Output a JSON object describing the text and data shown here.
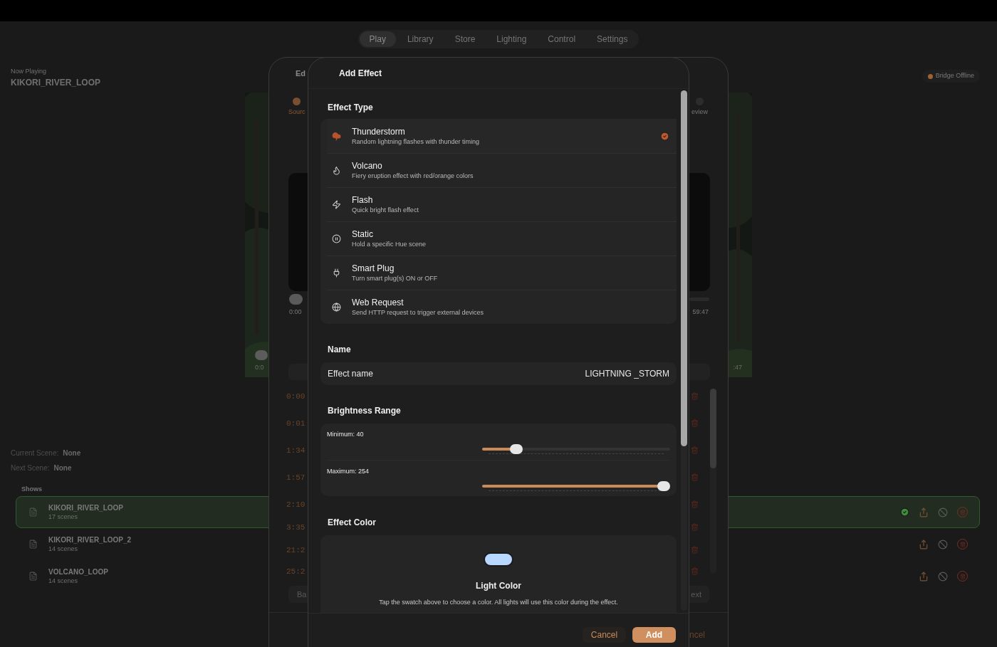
{
  "tabs": [
    {
      "label": "Play",
      "selected": true
    },
    {
      "label": "Library",
      "selected": false
    },
    {
      "label": "Store",
      "selected": false
    },
    {
      "label": "Lighting",
      "selected": false
    },
    {
      "label": "Control",
      "selected": false
    },
    {
      "label": "Settings",
      "selected": false
    }
  ],
  "now_playing": {
    "label": "Now Playing",
    "title": "KIKORI_RIVER_LOOP"
  },
  "bridge_status": {
    "label": "Bridge Offline",
    "color": "#a0622e"
  },
  "video": {
    "time_start": "0:0",
    "time_end": ":47"
  },
  "scene_info": [
    {
      "label": "Current Scene:",
      "value": "None"
    },
    {
      "label": "Next Scene:",
      "value": "None"
    }
  ],
  "shows": {
    "heading": "Shows",
    "items": [
      {
        "name": "KIKORI_RIVER_LOOP",
        "count": "17 scenes",
        "selected": true
      },
      {
        "name": "KIKORI_RIVER_LOOP_2",
        "count": "14 scenes",
        "selected": false
      },
      {
        "name": "VOLCANO_LOOP",
        "count": "14 scenes",
        "selected": false
      }
    ]
  },
  "edit_sheet": {
    "title": "Ed",
    "steps": [
      {
        "label": "Sourc",
        "selected": true
      },
      {
        "label": "eview",
        "selected": false
      }
    ],
    "time_start": "0:00",
    "time_end": "59:47",
    "cue_times": [
      "0:00",
      "0:01",
      "1:34",
      "1:57",
      "2:10",
      "3:35",
      "21:2",
      "25:2"
    ],
    "back_button": "Ba",
    "next_button": "ext",
    "cancel_button": "ncel"
  },
  "add_effect": {
    "title": "Add Effect",
    "effect_type": {
      "heading": "Effect Type",
      "options": [
        {
          "name": "Thunderstorm",
          "description": "Random lightning flashes with thunder timing",
          "selected": true
        },
        {
          "name": "Volcano",
          "description": "Fiery eruption effect with red/orange colors",
          "selected": false
        },
        {
          "name": "Flash",
          "description": "Quick bright flash effect",
          "selected": false
        },
        {
          "name": "Static",
          "description": "Hold a specific Hue scene",
          "selected": false
        },
        {
          "name": "Smart Plug",
          "description": "Turn smart plug(s) ON or OFF",
          "selected": false
        },
        {
          "name": "Web Request",
          "description": "Send HTTP request to trigger external devices",
          "selected": false
        }
      ]
    },
    "name": {
      "heading": "Name",
      "label": "Effect name",
      "value": "LIGHTNING _STORM"
    },
    "brightness": {
      "heading": "Brightness Range",
      "sliders": [
        {
          "label": "Minimum: 40",
          "level": 0.16
        },
        {
          "label": "Maximum: 254",
          "level": 1
        }
      ]
    },
    "effect_color": {
      "heading": "Effect Color",
      "color": "#b9d8ff",
      "title": "Light Color",
      "description": "Tap the swatch above to choose a color. All lights will use this color during the effect."
    },
    "buttons": {
      "cancel": "Cancel",
      "add": "Add"
    }
  }
}
